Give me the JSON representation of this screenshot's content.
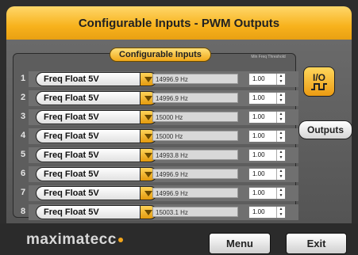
{
  "header": {
    "title": "Configurable Inputs - PWM Outputs"
  },
  "panel": {
    "title": "Configurable Inputs",
    "threshold_label": "Min Freq Threshold"
  },
  "rows": [
    {
      "num": "1",
      "mode": "Freq Float 5V",
      "freq": "14996.9 Hz",
      "threshold": "1.00"
    },
    {
      "num": "2",
      "mode": "Freq Float 5V",
      "freq": "14996.9 Hz",
      "threshold": "1.00"
    },
    {
      "num": "3",
      "mode": "Freq Float 5V",
      "freq": "15000 Hz",
      "threshold": "1.00"
    },
    {
      "num": "4",
      "mode": "Freq Float 5V",
      "freq": "15000 Hz",
      "threshold": "1.00"
    },
    {
      "num": "5",
      "mode": "Freq Float 5V",
      "freq": "14993.8 Hz",
      "threshold": "1.00"
    },
    {
      "num": "6",
      "mode": "Freq Float 5V",
      "freq": "14996.9 Hz",
      "threshold": "1.00"
    },
    {
      "num": "7",
      "mode": "Freq Float 5V",
      "freq": "14996.9 Hz",
      "threshold": "1.00"
    },
    {
      "num": "8",
      "mode": "Freq Float 5V",
      "freq": "15003.1 Hz",
      "threshold": "1.00"
    }
  ],
  "side": {
    "io_label": "I/O",
    "outputs_label": "Outputs"
  },
  "footer": {
    "logo": "maximatecc",
    "menu_label": "Menu",
    "exit_label": "Exit"
  },
  "colors": {
    "accent": "#f7b21c",
    "background": "#5d5d5d"
  },
  "icons": {
    "io": "pulse-wave-icon",
    "dropdown": "chevron-down-icon",
    "spinner": "up-down-arrows-icon"
  }
}
